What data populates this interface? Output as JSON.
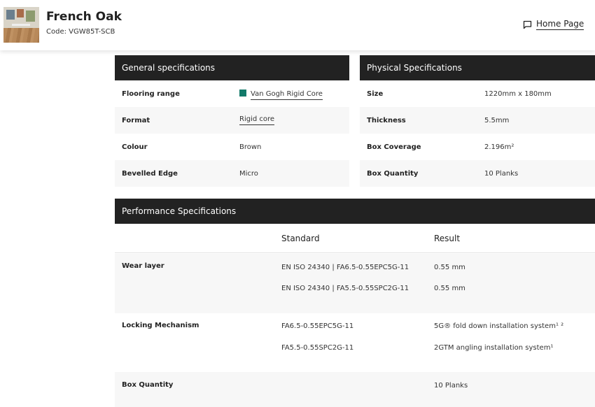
{
  "header": {
    "title": "French Oak",
    "code": "Code: VGW85T-SCB",
    "home_link": "Home Page"
  },
  "general": {
    "heading": "General specifications",
    "rows": [
      {
        "label": "Flooring range",
        "value": "Van Gogh Rigid Core"
      },
      {
        "label": "Format",
        "value": "Rigid core"
      },
      {
        "label": "Colour",
        "value": "Brown"
      },
      {
        "label": "Bevelled Edge",
        "value": "Micro"
      }
    ],
    "swatch_color": "#137a6a"
  },
  "physical": {
    "heading": "Physical Specifications",
    "rows": [
      {
        "label": "Size",
        "value": "1220mm x 180mm"
      },
      {
        "label": "Thickness",
        "value": "5.5mm"
      },
      {
        "label": "Box Coverage",
        "value": "2.196m²"
      },
      {
        "label": "Box Quantity",
        "value": "10 Planks"
      }
    ]
  },
  "performance": {
    "heading": "Performance Specifications",
    "col_standard": "Standard",
    "col_result": "Result",
    "rows": [
      {
        "label": "Wear layer",
        "standards": [
          "EN ISO 24340 | FA6.5-0.55EPC5G-11",
          "EN ISO 24340 | FA5.5-0.55SPC2G-11"
        ],
        "results": [
          "0.55 mm",
          "0.55 mm"
        ]
      },
      {
        "label": "Locking Mechanism",
        "standards": [
          "FA6.5-0.55EPC5G-11",
          "FA5.5-0.55SPC2G-11"
        ],
        "results": [
          "5G® fold down installation system¹ ²",
          "2GTM angling installation system¹"
        ]
      },
      {
        "label": "Box Quantity",
        "standards": [],
        "results": [
          "10 Planks"
        ]
      }
    ]
  },
  "colors": {
    "header_bar": "#222222",
    "alt_row": "#f7f7f7"
  }
}
